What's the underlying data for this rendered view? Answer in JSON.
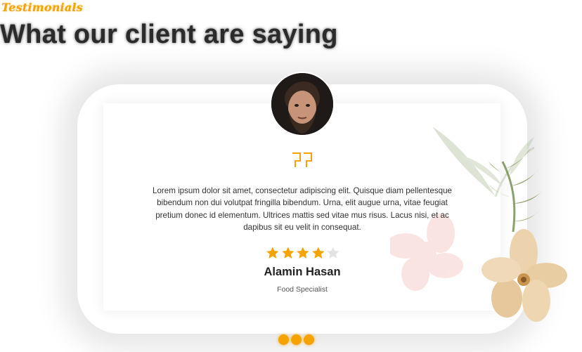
{
  "section": {
    "eyebrow": "Testimonials",
    "headline": "What our client are saying"
  },
  "testimonial": {
    "text": "Lorem ipsum dolor sit amet, consectetur adipiscing elit. Quisque diam pellentesque bibendum non dui volutpat fringilla bibendum. Urna, elit augue urna, vitae feugiat pretium donec id elementum. Ultrices mattis sed vitae mus risus. Lacus nisi, et ac dapibus sit eu velit in consequat.",
    "rating": 4,
    "rating_max": 5,
    "name": "Alamin Hasan",
    "role": "Food Specialist",
    "quote_icon": "quote-icon"
  },
  "pagination": {
    "count": 3,
    "active_index": 0
  },
  "colors": {
    "accent": "#f5a300",
    "star_off": "#e3e3e3",
    "text": "#222222"
  }
}
